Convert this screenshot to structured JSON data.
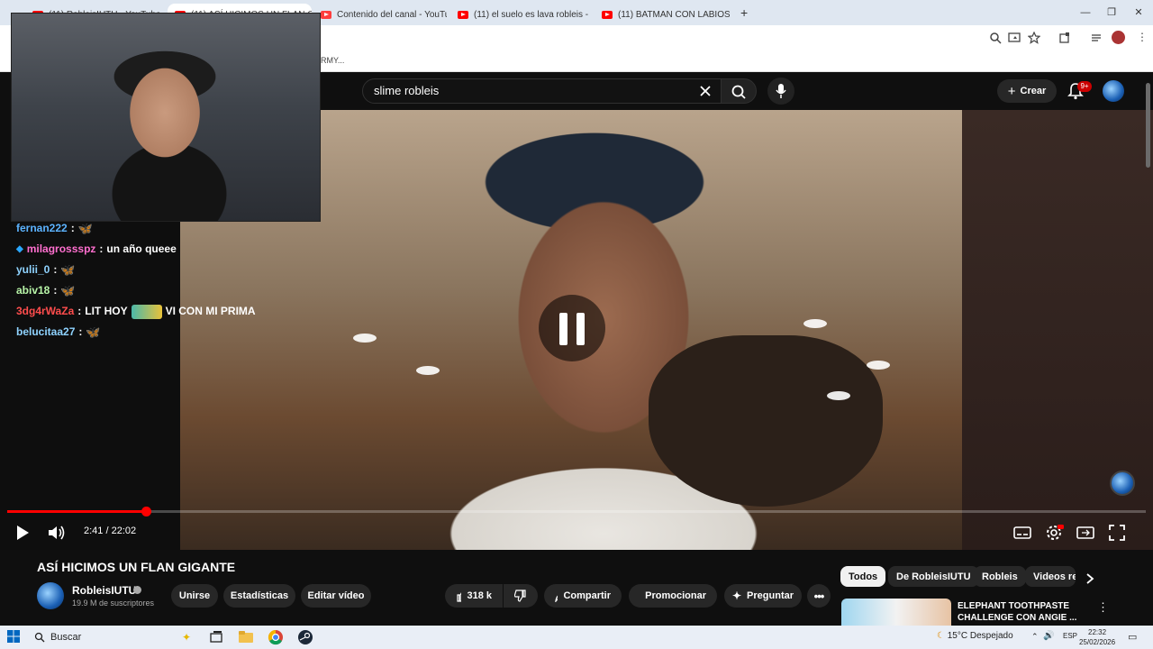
{
  "browser": {
    "tabs": [
      {
        "title": "(11) RobleisIUTU - YouTube"
      },
      {
        "title": "(11) ASÍ HICIMOS UN FLAN GIGANTE"
      },
      {
        "title": "Contenido del canal - YouTube"
      },
      {
        "title": "(11) el suelo es lava robleis - YouTube"
      },
      {
        "title": "(11) BATMAN CON LABIOS DE"
      }
    ],
    "new_tab": "+",
    "window_controls": {
      "minimize": "—",
      "restore": "❐",
      "close": "✕"
    },
    "bookmark_text": "RMY..."
  },
  "youtube": {
    "search_value": "slime robleis",
    "create_label": "Crear",
    "notifications_badge": "9+",
    "accent_color": "#ff0000"
  },
  "chat": [
    {
      "user": "fernan222",
      "color": "#5cb3ff",
      "message": ""
    },
    {
      "user": "milagrossspz",
      "color": "#ff6fcf",
      "message": "un año queee"
    },
    {
      "user": "yulii_0",
      "color": "#8fd3ff",
      "message": ""
    },
    {
      "user": "abiv18",
      "color": "#b8f5a8",
      "message": ""
    },
    {
      "user": "3dg4rWaZa",
      "color": "#ff4d4d",
      "message": "LIT HOY",
      "message2": "VI CON MI PRIMA"
    },
    {
      "user": "belucitaa27",
      "color": "#8fd3ff",
      "message": ""
    }
  ],
  "player": {
    "current_time": "2:41",
    "duration": "22:02",
    "time_display": "2:41 / 22:02",
    "progress": 0.1218
  },
  "video_info": {
    "title": "ASÍ HICIMOS UN FLAN GIGANTE",
    "channel": "RobleisIUTU",
    "subscribers": "19.9 M de suscriptores",
    "buttons": {
      "join": "Unirse",
      "stats": "Estadísticas",
      "edit": "Editar vídeo",
      "likes": "318 k",
      "share": "Compartir",
      "promote": "Promocionar",
      "ask": "Preguntar"
    }
  },
  "recommendations": {
    "chips": [
      "Todos",
      "De RobleisIUTU",
      "Robleis",
      "Videos re"
    ],
    "first_title": "ELEPHANT TOOTHPASTE CHALLENGE CON ANGIE ..."
  },
  "taskbar": {
    "search_placeholder": "Buscar",
    "weather": "15°C  Despejado",
    "language": "ESP",
    "time": "22:32",
    "date": "25/02/2026"
  }
}
